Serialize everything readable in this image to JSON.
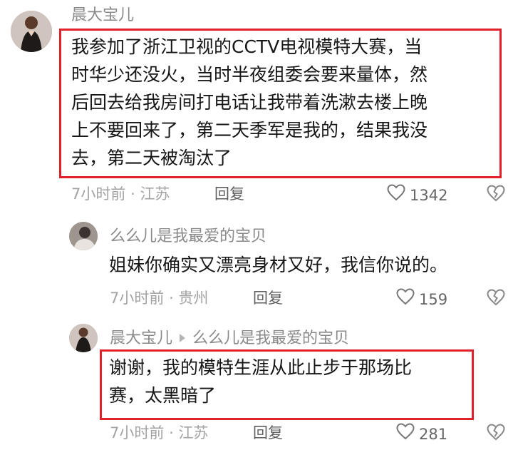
{
  "comments": [
    {
      "username": "晨大宝儿",
      "lines": [
        "我参加了浙江卫视的CCTV电视模特大赛，当",
        "时华少还没火，当时半夜组委会要来量体，然",
        "后回去给我房间打电话让我带着洗漱去楼上晚",
        "上不要回来了，第二天季军是我的，结果我没",
        "去，第二天被淘汰了"
      ],
      "time": "7小时前",
      "location": "江苏",
      "reply_label": "回复",
      "likes": "1342"
    },
    {
      "username": "么么儿是我最爱的宝贝",
      "lines": [
        "姐妹你确实又漂亮身材又好，我信你说的。"
      ],
      "time": "7小时前",
      "location": "贵州",
      "reply_label": "回复",
      "likes": "159"
    },
    {
      "username": "晨大宝儿",
      "reply_to": "么么儿是我最爱的宝贝",
      "lines": [
        "谢谢，我的模特生涯从此止步于那场比",
        "赛，太黑暗了"
      ],
      "time": "7小时前",
      "location": "江苏",
      "reply_label": "回复",
      "likes": "281"
    }
  ],
  "meta_separator": "·",
  "icons": {
    "like": "heart-outline-icon",
    "dislike": "broken-heart-icon",
    "reply_arrow": "triangle-right-icon"
  },
  "colors": {
    "highlight_box": "#e0202a",
    "username": "#8a8a8a",
    "meta": "#a3a3a3"
  }
}
